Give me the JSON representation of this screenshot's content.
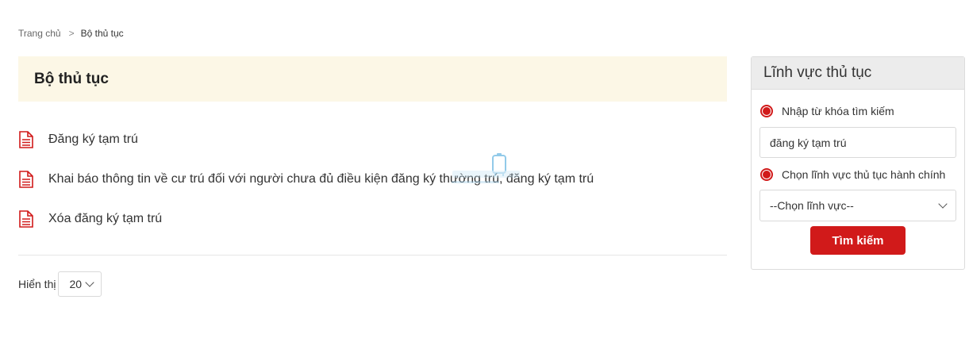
{
  "breadcrumb": {
    "home": "Trang chủ",
    "separator": ">",
    "current": "Bộ thủ tục"
  },
  "main": {
    "title": "Bộ thủ tục",
    "procedures": [
      {
        "label": "Đăng ký tạm trú",
        "icon": "document-icon"
      },
      {
        "label": "Khai báo thông tin về cư trú đối với người chưa đủ điều kiện đăng ký thường trú, đăng ký tạm trú",
        "icon": "document-icon"
      },
      {
        "label": "Xóa đăng ký tạm trú",
        "icon": "document-icon"
      }
    ],
    "pager": {
      "label": "Hiển thị",
      "page_size": "20"
    }
  },
  "sidebar": {
    "title": "Lĩnh vực thủ tục",
    "keyword_option_label": "Nhập từ khóa tìm kiếm",
    "keyword_value": "đăng ký tạm trú",
    "field_option_label": "Chọn lĩnh vực thủ tục hành chính",
    "field_select_value": "--Chọn lĩnh vực--",
    "search_button": "Tìm kiếm"
  },
  "colors": {
    "accent": "#d11a1a",
    "title_bg": "#fcf7e6",
    "sidebar_header_bg": "#ececec"
  }
}
